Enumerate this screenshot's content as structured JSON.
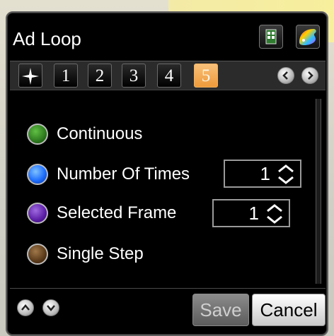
{
  "window": {
    "title": "Ad Loop"
  },
  "header_icons": [
    {
      "name": "film-icon"
    },
    {
      "name": "color-palette-icon"
    }
  ],
  "tabs": [
    {
      "label": "✦",
      "name": "tab-all"
    },
    {
      "label": "1",
      "name": "tab-1"
    },
    {
      "label": "2",
      "name": "tab-2"
    },
    {
      "label": "3",
      "name": "tab-3"
    },
    {
      "label": "4",
      "name": "tab-4"
    },
    {
      "label": "5",
      "name": "tab-5",
      "active": true
    }
  ],
  "options": [
    {
      "label": "Continuous",
      "color": "#2e7a1f"
    },
    {
      "label": "Number Of Times",
      "color": "#1f6fff",
      "value": "1",
      "selected": true
    },
    {
      "label": "Selected Frame",
      "color": "#5b1ea6",
      "value": "1"
    },
    {
      "label": "Single Step",
      "color": "#5a3a1a"
    }
  ],
  "buttons": {
    "save": "Save",
    "cancel": "Cancel"
  }
}
